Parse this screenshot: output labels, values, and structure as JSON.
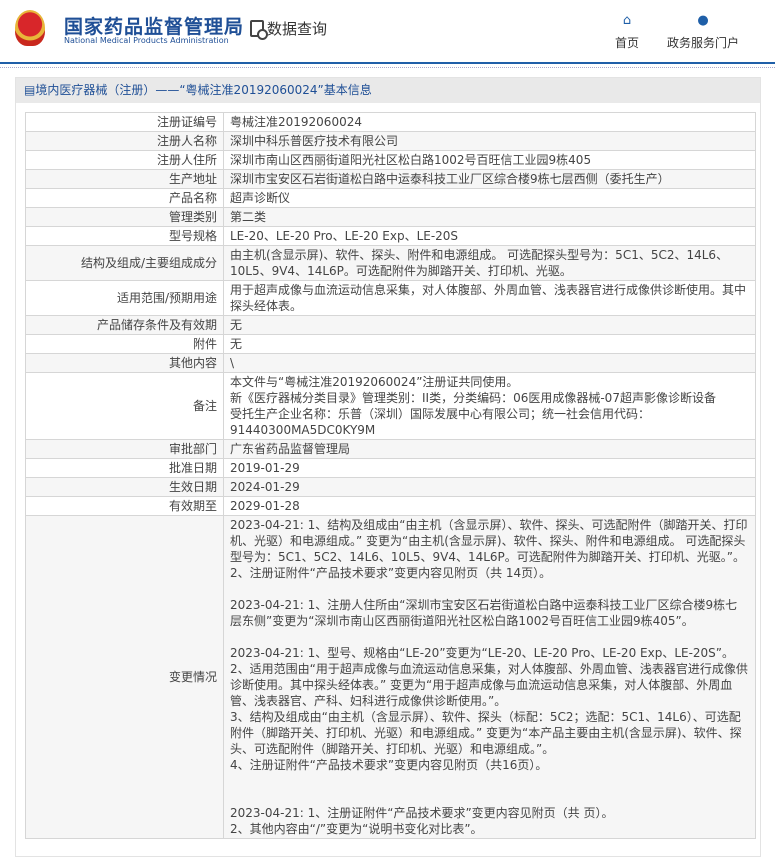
{
  "header": {
    "brand_cn": "国家药品监督管理局",
    "brand_en": "National Medical Products Administration",
    "query": "数据查询",
    "nav": [
      {
        "label": "首页",
        "icon": "home-icon"
      },
      {
        "label": "政务服务门户",
        "icon": "user-icon"
      }
    ]
  },
  "panel_title": "境内医疗器械（注册）——“粤械注准20192060024”基本信息",
  "rows": [
    {
      "label": "注册证编号",
      "value": "粤械注准20192060024"
    },
    {
      "label": "注册人名称",
      "value": "深圳中科乐普医疗技术有限公司"
    },
    {
      "label": "注册人住所",
      "value": "深圳市南山区西丽街道阳光社区松白路1002号百旺信工业园9栋405"
    },
    {
      "label": "生产地址",
      "value": "深圳市宝安区石岩街道松白路中运泰科技工业厂区综合楼9栋七层西侧（委托生产）"
    },
    {
      "label": "产品名称",
      "value": "超声诊断仪"
    },
    {
      "label": "管理类别",
      "value": "第二类"
    },
    {
      "label": "型号规格",
      "value": "LE-20、LE-20 Pro、LE-20 Exp、LE-20S"
    },
    {
      "label": "结构及组成/主要组成成分",
      "value": "由主机(含显示屏)、软件、探头、附件和电源组成。 可选配探头型号为：5C1、5C2、14L6、10L5、9V4、14L6P。可选配附件为脚踏开关、打印机、光驱。"
    },
    {
      "label": "适用范围/预期用途",
      "value": "用于超声成像与血流运动信息采集，对人体腹部、外周血管、浅表器官进行成像供诊断使用。其中探头经体表。"
    },
    {
      "label": "产品储存条件及有效期",
      "value": "无"
    },
    {
      "label": "附件",
      "value": "无"
    },
    {
      "label": "其他内容",
      "value": "\\"
    },
    {
      "label": "备注",
      "value": "本文件与“粤械注准20192060024”注册证共同使用。\n新《医疗器械分类目录》管理类别：II类，分类编码：06医用成像器械-07超声影像诊断设备\n受托生产企业名称：乐普（深圳）国际发展中心有限公司；统一社会信用代码：91440300MA5DC0KY9M"
    },
    {
      "label": "审批部门",
      "value": "广东省药品监督管理局"
    },
    {
      "label": "批准日期",
      "value": "2019-01-29"
    },
    {
      "label": "生效日期",
      "value": "2024-01-29"
    },
    {
      "label": "有效期至",
      "value": "2029-01-28"
    },
    {
      "label": "变更情况",
      "value": "2023-04-21: 1、结构及组成由“由主机（含显示屏）、软件、探头、可选配附件（脚踏开关、打印机、光驱）和电源组成。” 变更为“由主机(含显示屏)、软件、探头、附件和电源组成。 可选配探头型号为：5C1、5C2、14L6、10L5、9V4、14L6P。可选配附件为脚踏开关、打印机、光驱。”。\n2、注册证附件“产品技术要求”变更内容见附页（共 14页）。\n\n2023-04-21: 1、注册人住所由“深圳市宝安区石岩街道松白路中运泰科技工业厂区综合楼9栋七层东侧”变更为“深圳市南山区西丽街道阳光社区松白路1002号百旺信工业园9栋405”。\n\n2023-04-21: 1、型号、规格由“LE-20”变更为“LE-20、LE-20 Pro、LE-20 Exp、LE-20S”。\n2、适用范围由“用于超声成像与血流运动信息采集，对人体腹部、外周血管、浅表器官进行成像供诊断使用。其中探头经体表。” 变更为“用于超声成像与血流运动信息采集，对人体腹部、外周血管、浅表器官、产科、妇科进行成像供诊断使用。”。\n3、结构及组成由“由主机（含显示屏）、软件、探头（标配：5C2；选配：5C1、14L6）、可选配附件（脚踏开关、打印机、光驱）和电源组成。” 变更为“本产品主要由主机(含显示屏)、软件、探头、可选配附件（脚踏开关、打印机、光驱）和电源组成。”。\n4、注册证附件“产品技术要求”变更内容见附页（共16页）。\n\n\n2023-04-21: 1、注册证附件“产品技术要求”变更内容见附页（共 页）。\n2、其他内容由“/”变更为“说明书变化对比表”。"
    }
  ]
}
